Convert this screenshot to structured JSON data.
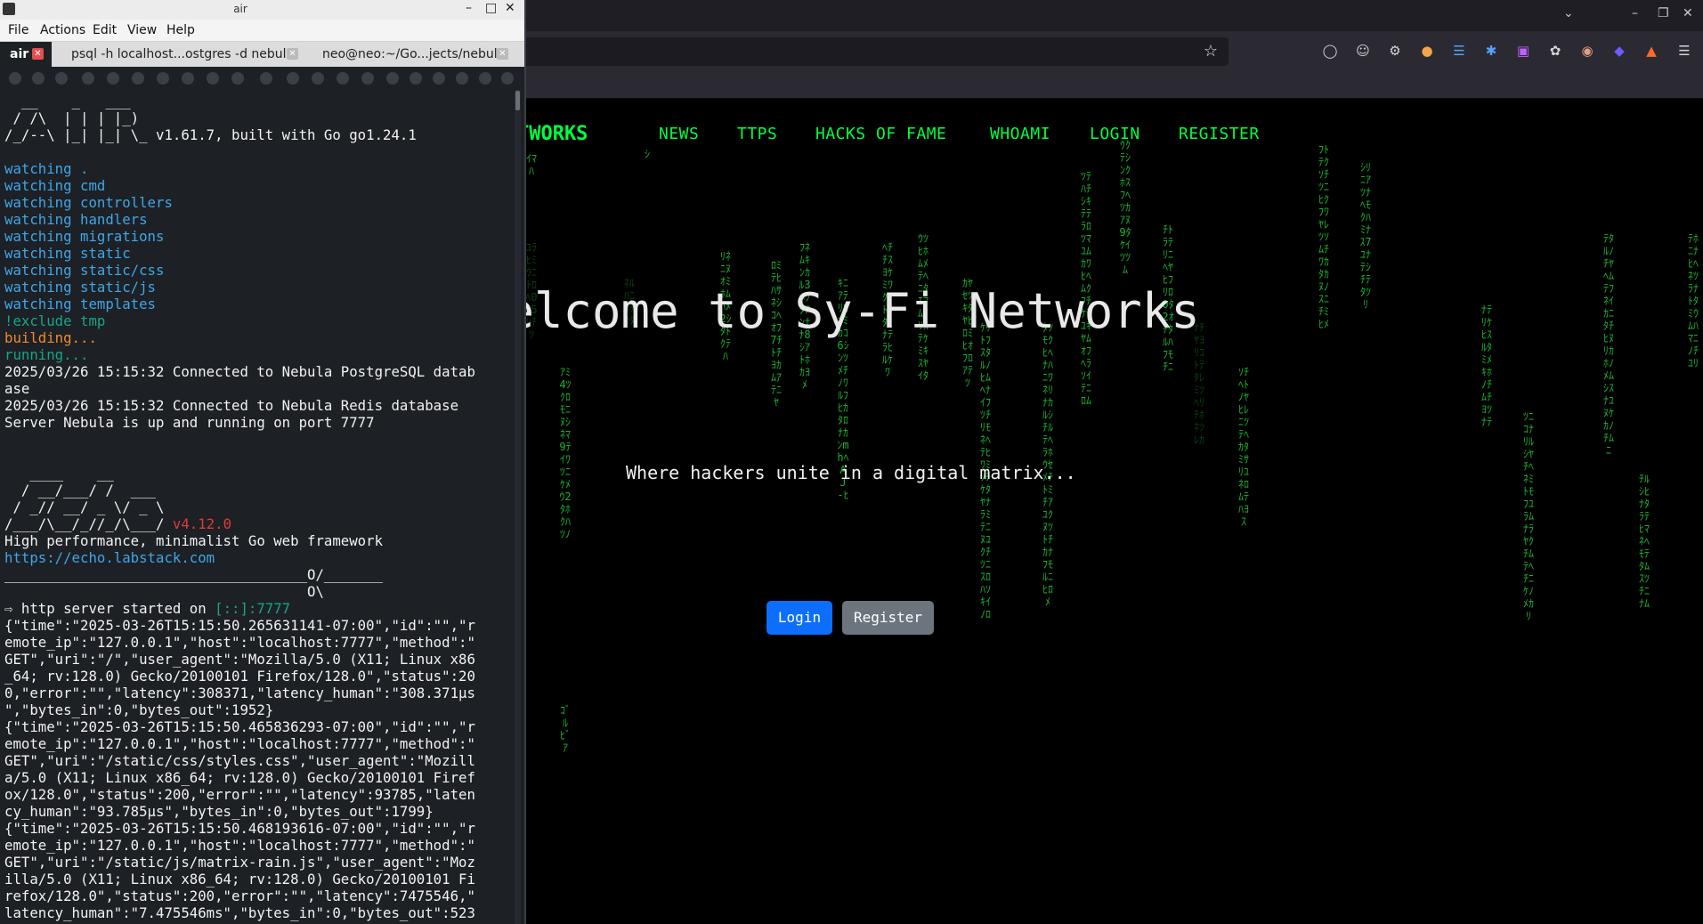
{
  "terminal": {
    "title": "air",
    "menu": [
      "File",
      "Actions",
      "Edit",
      "View",
      "Help"
    ],
    "tabs": [
      {
        "label": "air",
        "active": true
      },
      {
        "label": "psql -h localhost...ostgres -d nebula",
        "active": false
      },
      {
        "label": "neo@neo:~/Go...jects/nebula",
        "active": false
      }
    ],
    "air_banner": [
      "  __    _   ___",
      " / /\\  | | | |_)",
      "/_/--\\ |_| |_| \\_ v1.61.7, built with Go go1.24.1"
    ],
    "watching": [
      "watching .",
      "watching cmd",
      "watching controllers",
      "watching handlers",
      "watching migrations",
      "watching static",
      "watching static/css",
      "watching static/js",
      "watching templates"
    ],
    "exclude_line": "!exclude tmp",
    "building_line": "building...",
    "running_line": "running...",
    "log_lines": [
      "2025/03/26 15:15:32 Connected to Nebula PostgreSQL datab",
      "ase",
      "2025/03/26 15:15:32 Connected to Nebula Redis database",
      "Server Nebula is up and running on port 7777"
    ],
    "echo_banner": [
      "   ____    __",
      "  / __/___/ /  ___",
      " / _// __/ _ \\/ _ \\",
      "/___/\\__/_//_/\\___/ "
    ],
    "echo_version": "v4.12.0",
    "echo_tagline": "High performance, minimalist Go web framework",
    "echo_url": "https://echo.labstack.com",
    "echo_rule_1": "____________________________________O/_______",
    "echo_rule_2": "                                    O\\",
    "server_started_prefix": "⇨ http server started on ",
    "server_addr": "[::]:7777",
    "request_log": [
      "{\"time\":\"2025-03-26T15:15:50.265631141-07:00\",\"id\":\"\",\"r",
      "emote_ip\":\"127.0.0.1\",\"host\":\"localhost:7777\",\"method\":\"",
      "GET\",\"uri\":\"/\",\"user_agent\":\"Mozilla/5.0 (X11; Linux x86",
      "_64; rv:128.0) Gecko/20100101 Firefox/128.0\",\"status\":20",
      "0,\"error\":\"\",\"latency\":308371,\"latency_human\":\"308.371µs",
      "\",\"bytes_in\":0,\"bytes_out\":1952}",
      "{\"time\":\"2025-03-26T15:15:50.465836293-07:00\",\"id\":\"\",\"r",
      "emote_ip\":\"127.0.0.1\",\"host\":\"localhost:7777\",\"method\":\"",
      "GET\",\"uri\":\"/static/css/styles.css\",\"user_agent\":\"Mozill",
      "a/5.0 (X11; Linux x86_64; rv:128.0) Gecko/20100101 Firef",
      "ox/128.0\",\"status\":200,\"error\":\"\",\"latency\":93785,\"laten",
      "cy_human\":\"93.785µs\",\"bytes_in\":0,\"bytes_out\":1799}",
      "{\"time\":\"2025-03-26T15:15:50.468193616-07:00\",\"id\":\"\",\"r",
      "emote_ip\":\"127.0.0.1\",\"host\":\"localhost:7777\",\"method\":\"",
      "GET\",\"uri\":\"/static/js/matrix-rain.js\",\"user_agent\":\"Moz",
      "illa/5.0 (X11; Linux x86_64; rv:128.0) Gecko/20100101 Fi",
      "refox/128.0\",\"status\":200,\"error\":\"\",\"latency\":7475546,\"",
      "latency_human\":\"7.475546ms\",\"bytes_in\":0,\"bytes_out\":523"
    ]
  },
  "browser": {
    "toolbar_icons": [
      "pocket-icon",
      "account-icon",
      "extensions-icon",
      "addon-icon",
      "addon-icon",
      "addon-icon",
      "addon-icon",
      "addon-icon",
      "addon-icon",
      "addon-icon",
      "addon-icon",
      "menu-icon"
    ]
  },
  "site": {
    "brand": "SY-FI NETWORKS",
    "nav": [
      "NEWS",
      "TTPS",
      "HACKS OF FAME",
      "WHOAMI",
      "LOGIN",
      "REGISTER"
    ],
    "title": "Welcome to Sy-Fi Networks",
    "subtitle": "Where hackers unite in a digital matrix...",
    "login_button": "Login",
    "register_button": "Register"
  },
  "colors": {
    "matrix_green": "#00ff41",
    "login_blue": "#0d6efd",
    "register_gray": "#6c757d",
    "terminal_bg": "#1d2025"
  }
}
